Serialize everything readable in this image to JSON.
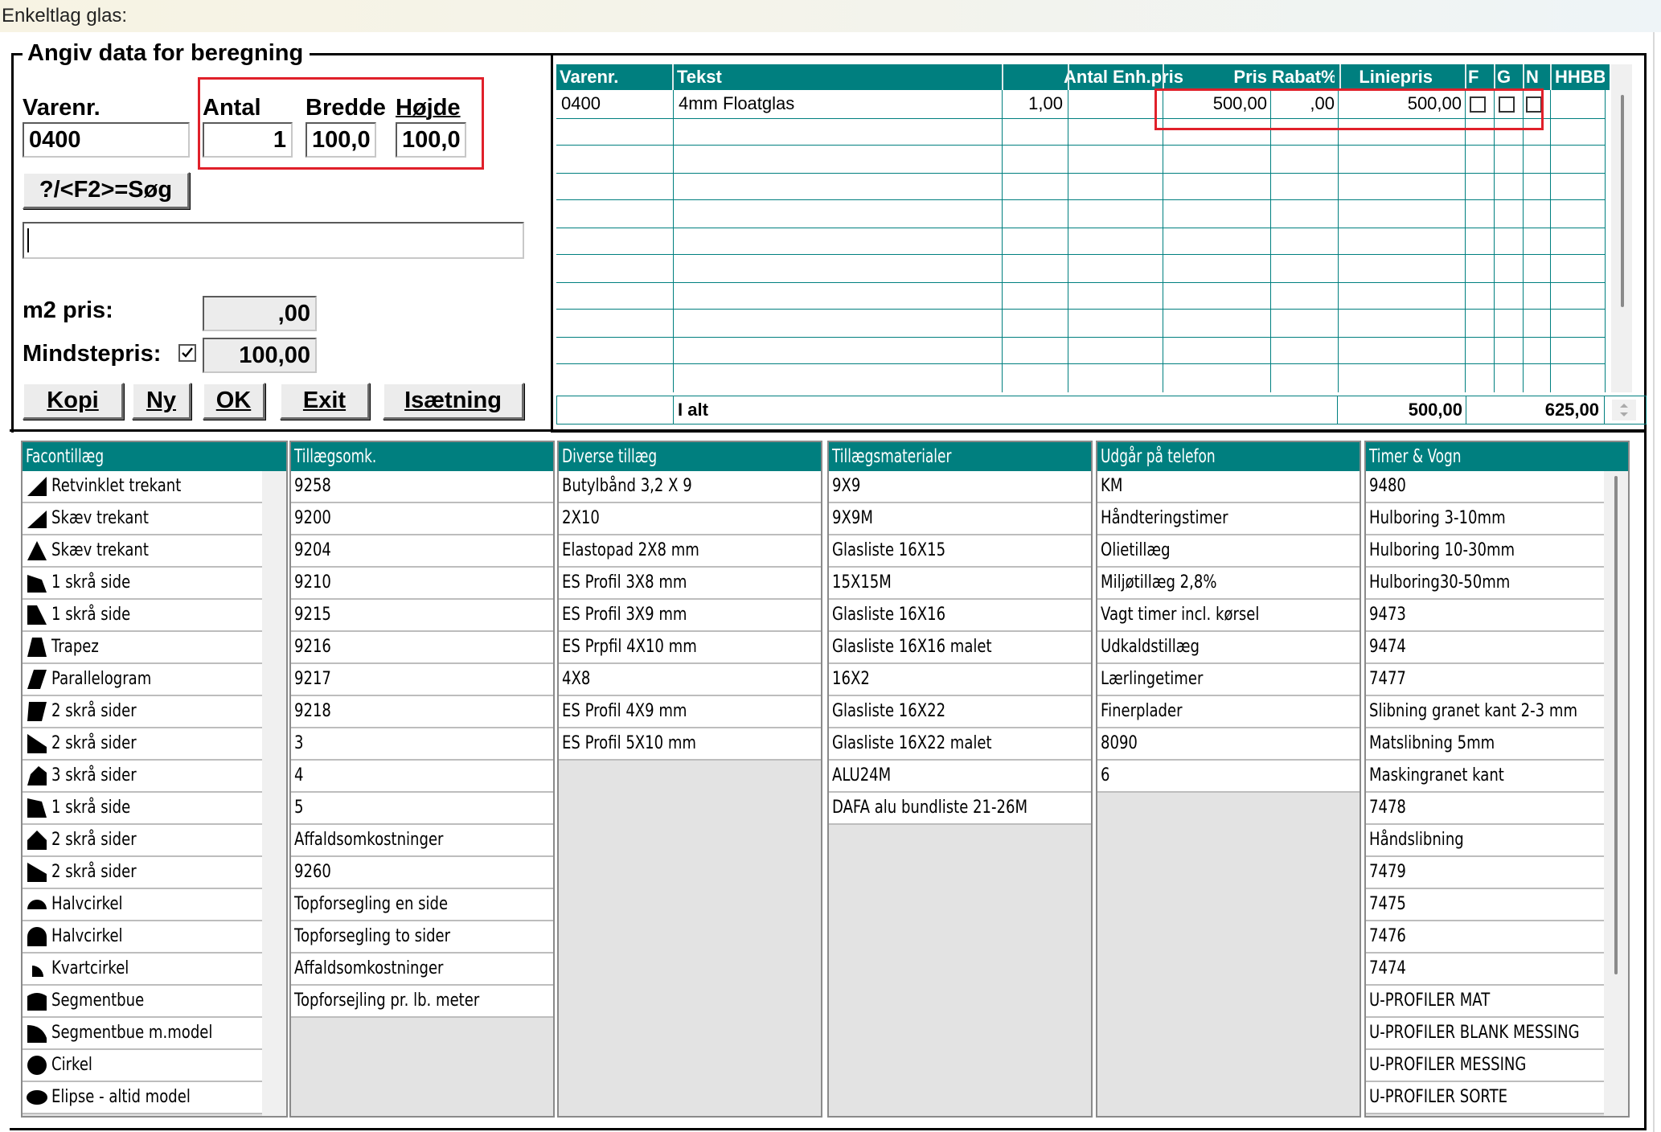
{
  "window": {
    "title": "Enkeltlag glas:"
  },
  "form": {
    "group_title": "Angiv data for beregning",
    "varenr": {
      "label": "Varenr.",
      "value": "0400"
    },
    "antal": {
      "label": "Antal",
      "value": "1"
    },
    "bredde": {
      "label": "Bredde",
      "value": "100,0"
    },
    "hojde": {
      "label": "Højde",
      "value": "100,0"
    },
    "search_button": "?/<F2>=Søg",
    "description_value": "",
    "m2pris": {
      "label": "m2 pris:",
      "value": ",00"
    },
    "mindstepris": {
      "label": "Mindstepris:",
      "checked": true,
      "value": "100,00"
    },
    "buttons": {
      "kopi": "Kopi",
      "ny": "Ny",
      "ok": "OK",
      "exit": "Exit",
      "isaetning": "Isætning"
    }
  },
  "grid": {
    "headers": [
      "Varenr.",
      "Tekst",
      "Antal",
      "Enh.pris",
      "Pris",
      "Rabat%",
      "Liniepris",
      "F",
      "G",
      "N",
      "HHBB"
    ],
    "rows": [
      {
        "varenr": "0400",
        "tekst": "4mm Floatglas",
        "antal": "1,00",
        "enhpris": "",
        "pris": "500,00",
        "rabat": ",00",
        "liniepris": "500,00",
        "f": false,
        "g": false,
        "n": false
      }
    ],
    "total": {
      "label": "I alt",
      "liniepris": "500,00",
      "sum": "625,00"
    }
  },
  "lists": [
    {
      "title": "Facontillæg",
      "items": [
        {
          "label": "Retvinklet trekant",
          "icon": "right-triangle-icon"
        },
        {
          "label": "Skæv trekant",
          "icon": "skew-triangle-icon"
        },
        {
          "label": "Skæv trekant",
          "icon": "triangle-icon"
        },
        {
          "label": "1 skrå side",
          "icon": "one-slanted-side-icon"
        },
        {
          "label": "1 skrå side",
          "icon": "one-slanted-side-alt-icon"
        },
        {
          "label": "Trapez",
          "icon": "trapezoid-icon"
        },
        {
          "label": "Parallelogram",
          "icon": "parallelogram-icon"
        },
        {
          "label": "2 skrå sider",
          "icon": "two-slanted-sides-icon"
        },
        {
          "label": "2 skrå sider",
          "icon": "two-slanted-sides-alt-icon"
        },
        {
          "label": "3 skrå sider",
          "icon": "three-slanted-sides-icon"
        },
        {
          "label": "1 skrå side",
          "icon": "one-slanted-top-icon"
        },
        {
          "label": "2 skrå sider",
          "icon": "gable-icon"
        },
        {
          "label": "2 skrå sider",
          "icon": "gable-alt-icon"
        },
        {
          "label": "Halvcirkel",
          "icon": "half-circle-icon"
        },
        {
          "label": "Halvcirkel",
          "icon": "half-circle-tall-icon"
        },
        {
          "label": "Kvartcirkel",
          "icon": "quarter-circle-icon"
        },
        {
          "label": "Segmentbue",
          "icon": "segment-arc-icon"
        },
        {
          "label": "Segmentbue m.model",
          "icon": "segment-arc-model-icon"
        },
        {
          "label": "Cirkel",
          "icon": "circle-icon"
        },
        {
          "label": "Elipse - altid model",
          "icon": "ellipse-icon"
        }
      ]
    },
    {
      "title": "Tillægsomk.",
      "items": [
        "9258",
        "9200",
        "9204",
        "9210",
        "9215",
        "9216",
        "9217",
        "9218",
        "3",
        "4",
        "5",
        "Affaldsomkostninger",
        "9260",
        "Topforsegling en side",
        "Topforsegling to sider",
        "Affaldsomkostninger",
        "Topforsejling pr. lb. meter"
      ]
    },
    {
      "title": "Diverse tillæg",
      "items": [
        "Butylbånd 3,2 X 9",
        "2X10",
        "Elastopad 2X8 mm",
        "ES Profil 3X8 mm",
        "ES Profil 3X9 mm",
        "ES Prpfil 4X10 mm",
        "4X8",
        "ES Profil 4X9 mm",
        "ES Profil 5X10 mm"
      ]
    },
    {
      "title": "Tillægsmaterialer",
      "items": [
        "9X9",
        "9X9M",
        "Glasliste 16X15",
        "15X15M",
        "Glasliste 16X16",
        "Glasliste 16X16 malet",
        "16X2",
        "Glasliste 16X22",
        "Glasliste 16X22 malet",
        "ALU24M",
        "DAFA alu bundliste 21-26M"
      ]
    },
    {
      "title": "Udgår på telefon",
      "items": [
        "KM",
        "Håndteringstimer",
        "Olietillæg",
        "Miljøtillæg 2,8%",
        "Vagt timer incl. kørsel",
        "Udkaldstillæg",
        "Lærlingetimer",
        "Finerplader",
        "8090",
        "6"
      ]
    },
    {
      "title": "Timer & Vogn",
      "items": [
        "9480",
        "Hulboring 3-10mm",
        "Hulboring 10-30mm",
        "Hulboring30-50mm",
        "9473",
        "9474",
        "7477",
        "Slibning granet kant 2-3 mm",
        "Matslibning 5mm",
        "Maskingranet kant",
        "7478",
        "Håndslibning",
        "7479",
        "7475",
        "7476",
        "7474",
        "U-PROFILER MAT",
        "U-PROFILER BLANK MESSING",
        "U-PROFILER MESSING",
        "U-PROFILER SORTE"
      ]
    }
  ]
}
